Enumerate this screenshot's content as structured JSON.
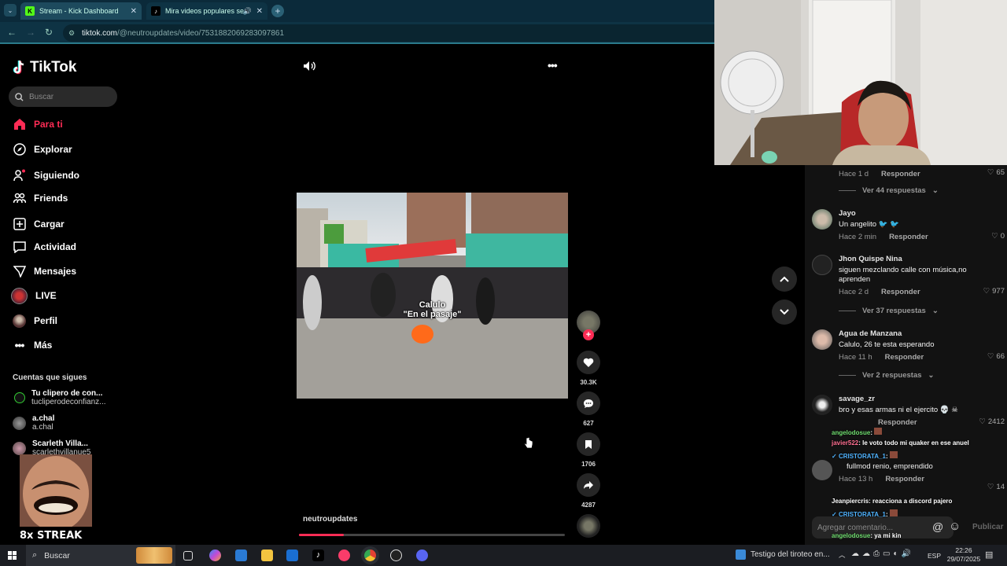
{
  "browser": {
    "tabs": [
      {
        "title": "Stream - Kick Dashboard",
        "favicon": "K",
        "color": "#53fc18"
      },
      {
        "title": "Mira videos populares sele",
        "favicon": "tiktok-icon",
        "color": "#000000"
      }
    ],
    "url_domain": "tiktok.com",
    "url_path": "/@neutroupdates/video/7531882069283097861"
  },
  "tiktok": {
    "logo": "TikTok",
    "search_placeholder": "Buscar",
    "nav": [
      {
        "label": "Para ti",
        "icon": "home-icon",
        "active": true
      },
      {
        "label": "Explorar",
        "icon": "compass-icon"
      },
      {
        "label": "Siguiendo",
        "icon": "following-icon"
      },
      {
        "label": "Friends",
        "icon": "friends-icon"
      },
      {
        "label": "Cargar",
        "icon": "upload-icon"
      },
      {
        "label": "Actividad",
        "icon": "activity-icon"
      },
      {
        "label": "Mensajes",
        "icon": "messages-icon"
      },
      {
        "label": "LIVE",
        "icon": "live-icon"
      },
      {
        "label": "Perfil",
        "icon": "profile-icon"
      },
      {
        "label": "Más",
        "icon": "more-icon"
      }
    ],
    "following_title": "Cuentas que sigues",
    "following": [
      {
        "name": "Tu clipero de con...",
        "handle": "tucliperodeconfianz..."
      },
      {
        "name": "a.chal",
        "handle": "a.chal"
      },
      {
        "name": "Scarleth Villa...",
        "handle": "scarlethvillanue5"
      }
    ],
    "video": {
      "overlay_line1": "Calulo",
      "overlay_line2": "\"En el pasaje\"",
      "author": "neutroupdates",
      "progress": 0.17
    },
    "actions": {
      "likes": "30.3K",
      "comments": "627",
      "saves": "1706",
      "shares": "4287"
    }
  },
  "comments": {
    "items": [
      {
        "meta_time": "Hace 1 d",
        "reply": "Responder",
        "likes": "65"
      },
      {
        "user": "Jayo",
        "text": "Un angelito 🐦 🐦",
        "time": "Hace 2 min",
        "reply": "Responder",
        "likes": "0"
      },
      {
        "user": "Jhon Quispe Nina",
        "text": "siguen mezclando calle con música,no aprenden",
        "time": "Hace 2 d",
        "reply": "Responder",
        "likes": "977"
      },
      {
        "user": "Agua de Manzana",
        "text": "Calulo, 26 te esta esperando",
        "time": "Hace 11 h",
        "reply": "Responder",
        "likes": "66"
      },
      {
        "user": "savage_zr",
        "text": "bro y esas armas ni el ejercito 💀 ☠",
        "time": "",
        "reply": "Responder",
        "likes": "2412"
      },
      {
        "user": "",
        "text": "fullmod renio, emprendido",
        "time": "Hace 13 h",
        "reply": "Responder",
        "likes": "14"
      }
    ],
    "view_replies": [
      "Ver 44 respuestas",
      "Ver 37 respuestas",
      "Ver 2 respuestas"
    ],
    "add_placeholder": "Agregar comentario...",
    "post_label": "Publicar"
  },
  "chat": [
    {
      "user": "angelodosue",
      "msg": ":",
      "color": "#6fdc6f"
    },
    {
      "user": "javier522",
      "msg": ": le voto todo mi quaker en ese anuel",
      "color": "#ff6f91"
    },
    {
      "user": "CRISTORATA_1",
      "msg": ":",
      "color": "#4fb3ff"
    },
    {
      "user": "Jeanpiercris",
      "msg": ": reacciona a discord pajero",
      "color": "#ffffff"
    },
    {
      "user": "CRISTORATA_1",
      "msg": ":",
      "color": "#4fb3ff"
    },
    {
      "user": "angelodosue",
      "msg": ": ya mi kin",
      "color": "#6fdc6f"
    }
  ],
  "streak": "8x STREAK",
  "taskbar": {
    "search": "Buscar",
    "news": "Testigo del tiroteo en...",
    "lang": "ESP",
    "time": "22:26",
    "date": "29/07/2025"
  }
}
